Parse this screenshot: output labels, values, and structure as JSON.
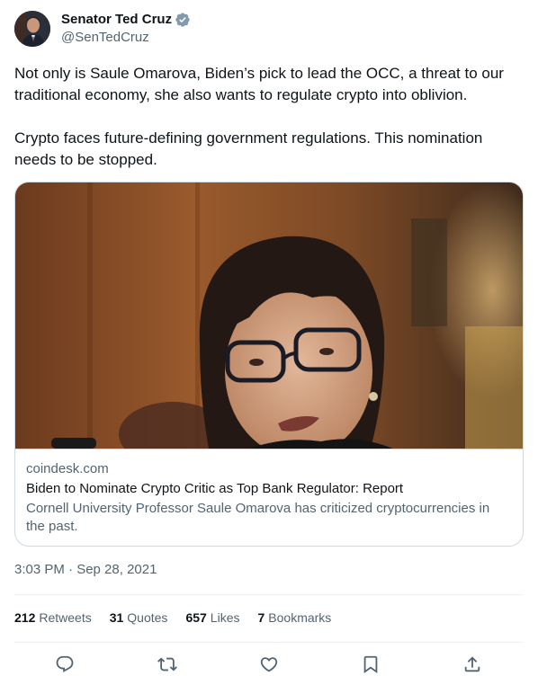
{
  "author": {
    "name": "Senator Ted Cruz",
    "handle": "@SenTedCruz",
    "verified": true
  },
  "tweet": {
    "paragraphs": [
      "Not only is Saule Omarova, Biden’s pick to lead the OCC, a threat to our traditional economy, she also wants to regulate crypto into oblivion.",
      "Crypto faces future-defining government regulations. This nomination needs to be stopped."
    ],
    "timestamp": "3:03 PM · Sep 28, 2021"
  },
  "card": {
    "domain": "coindesk.com",
    "title": "Biden to Nominate Crypto Critic as Top Bank Regulator: Report",
    "description": "Cornell University Professor Saule Omarova has criticized cryptocurrencies in the past."
  },
  "stats": [
    {
      "count": "212",
      "label": "Retweets"
    },
    {
      "count": "31",
      "label": "Quotes"
    },
    {
      "count": "657",
      "label": "Likes"
    },
    {
      "count": "7",
      "label": "Bookmarks"
    }
  ],
  "actions": [
    {
      "icon": "reply-icon"
    },
    {
      "icon": "retweet-icon"
    },
    {
      "icon": "like-icon"
    },
    {
      "icon": "bookmark-icon"
    },
    {
      "icon": "share-icon"
    }
  ],
  "colors": {
    "text": "#0f1419",
    "secondary": "#536471",
    "border": "#cfd9de",
    "verified": "#829aab"
  }
}
